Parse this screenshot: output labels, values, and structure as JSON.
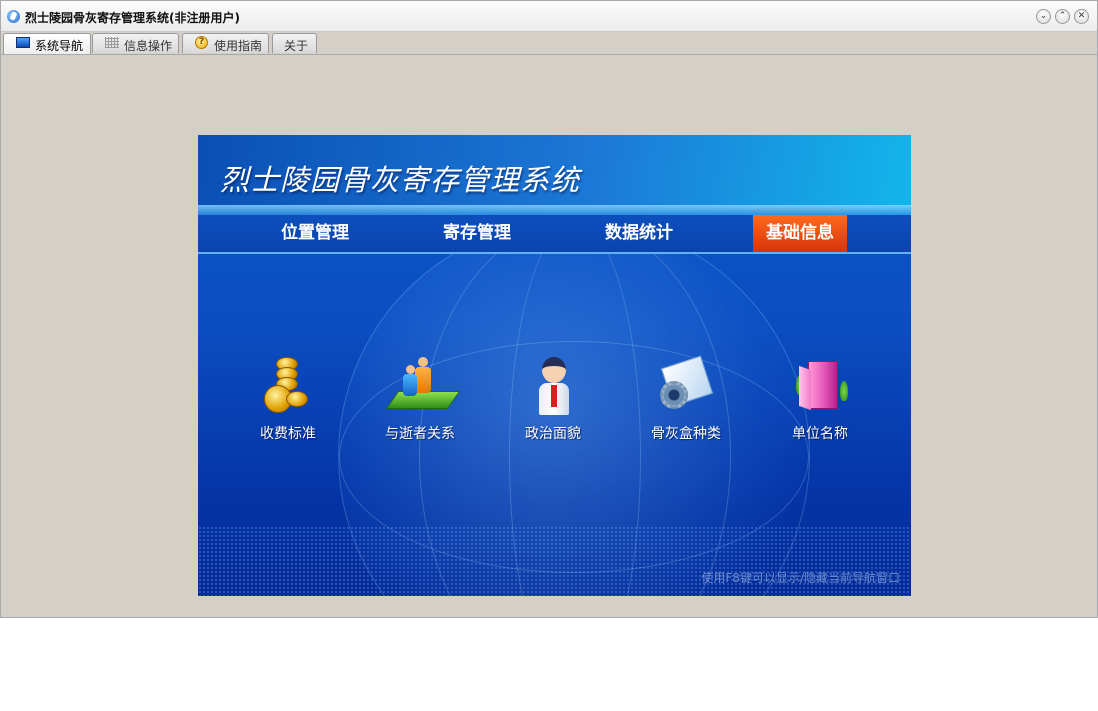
{
  "window": {
    "title": "烈士陵园骨灰寄存管理系统(非注册用户)",
    "controls": [
      "minimize",
      "maximize",
      "close"
    ]
  },
  "tabs": [
    {
      "label": "系统导航",
      "icon": "monitor-icon",
      "active": true
    },
    {
      "label": "信息操作",
      "icon": "grid-icon",
      "active": false
    },
    {
      "label": "使用指南",
      "icon": "help-icon",
      "active": false
    },
    {
      "label": "关于",
      "icon": "",
      "active": false
    }
  ],
  "banner": {
    "title": "烈士陵园骨灰寄存管理系统",
    "nav": [
      {
        "label": "位置管理",
        "active": false
      },
      {
        "label": "寄存管理",
        "active": false
      },
      {
        "label": "数据统计",
        "active": false
      },
      {
        "label": "基础信息",
        "active": true
      }
    ],
    "items": [
      {
        "label": "收费标准",
        "icon": "coins-icon"
      },
      {
        "label": "与逝者关系",
        "icon": "people-icon"
      },
      {
        "label": "政治面貌",
        "icon": "person-icon"
      },
      {
        "label": "骨灰盒种类",
        "icon": "folder-gear-icon"
      },
      {
        "label": "单位名称",
        "icon": "building-icon"
      }
    ],
    "hint": "使用F8键可以显示/隐藏当前导航窗口"
  },
  "colors": {
    "banner_blue": "#0a4fc2",
    "active_nav": "#e8450f",
    "window_bg": "#d4d0c8"
  }
}
